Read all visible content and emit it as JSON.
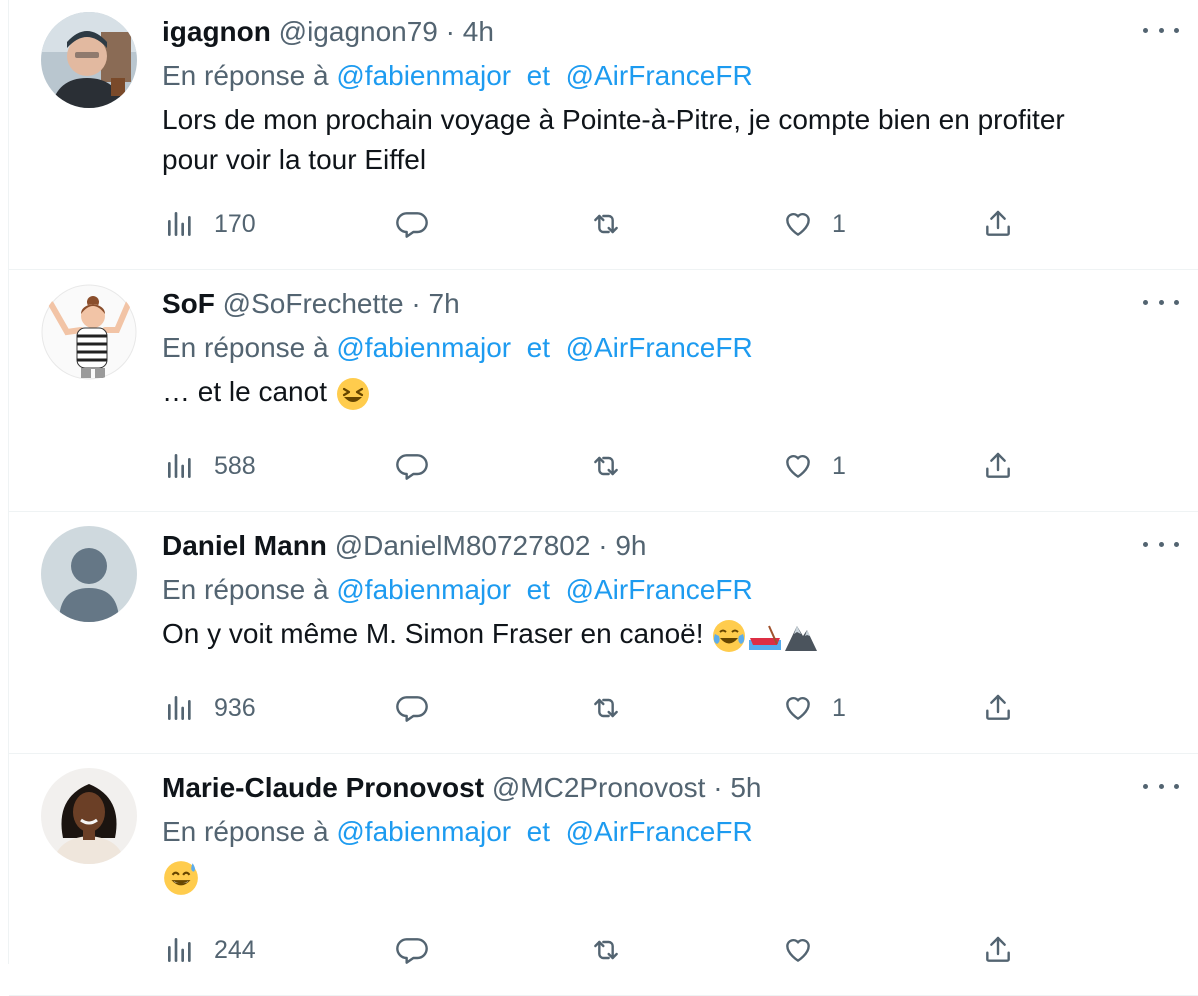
{
  "reply_prefix": "En réponse à",
  "reply_joiner": "et",
  "tweets": [
    {
      "name": "igagnon",
      "handle": "@igagnon79",
      "separator": "·",
      "time": "4h",
      "mention1": "@fabienmajor",
      "mention2": "@AirFranceFR",
      "text_line1": "Lors de mon prochain voyage à Pointe-à-Pitre, je compte bien en profiter",
      "text_line2": "pour voir la tour Eiffel",
      "views": "170",
      "likes": "1"
    },
    {
      "name": "SoF",
      "handle": "@SoFrechette",
      "separator": "·",
      "time": "7h",
      "mention1": "@fabienmajor",
      "mention2": "@AirFranceFR",
      "text_line1": "… et le canot",
      "views": "588",
      "likes": "1"
    },
    {
      "name": "Daniel Mann",
      "handle": "@DanielM80727802",
      "separator": "·",
      "time": "9h",
      "mention1": "@fabienmajor",
      "mention2": "@AirFranceFR",
      "text_line1": "On y voit même M. Simon Fraser en canoë!",
      "views": "936",
      "likes": "1"
    },
    {
      "name": "Marie-Claude Pronovost",
      "handle": "@MC2Pronovost",
      "separator": "·",
      "time": "5h",
      "mention1": "@fabienmajor",
      "mention2": "@AirFranceFR",
      "views": "244",
      "likes": ""
    }
  ],
  "colors": {
    "link": "#1d9bf0",
    "muted": "#536471",
    "text": "#0f1419"
  }
}
